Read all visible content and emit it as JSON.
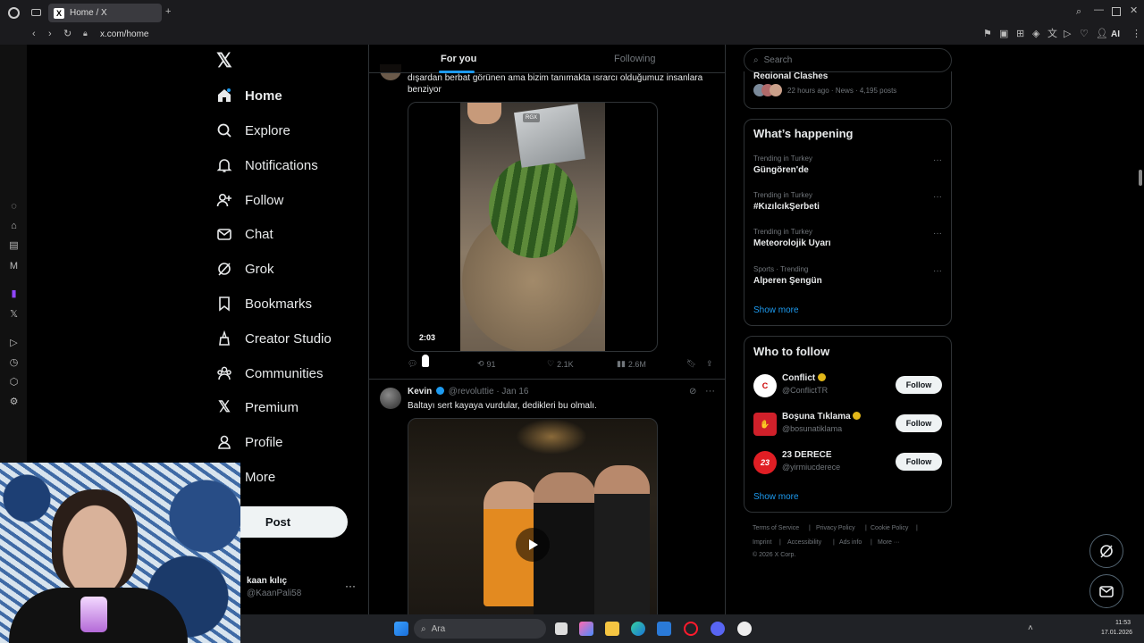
{
  "browser": {
    "tab_title": "Home / X",
    "url": "x.com/home",
    "ai_label": "AI"
  },
  "nav": {
    "items": [
      {
        "label": "Home",
        "icon": "home-icon"
      },
      {
        "label": "Explore",
        "icon": "search-icon"
      },
      {
        "label": "Notifications",
        "icon": "bell-icon"
      },
      {
        "label": "Follow",
        "icon": "person-add-icon"
      },
      {
        "label": "Chat",
        "icon": "mail-icon"
      },
      {
        "label": "Grok",
        "icon": "grok-icon"
      },
      {
        "label": "Bookmarks",
        "icon": "bookmark-icon"
      },
      {
        "label": "Creator Studio",
        "icon": "creator-icon"
      },
      {
        "label": "Communities",
        "icon": "communities-icon"
      },
      {
        "label": "Premium",
        "icon": "x-icon"
      },
      {
        "label": "Profile",
        "icon": "profile-icon"
      },
      {
        "label": "More",
        "icon": "more-icon"
      }
    ],
    "post_label": "Post",
    "account_name": "kaan kılıç",
    "account_handle": "@KaanPali58"
  },
  "feed": {
    "tabs": [
      "For you",
      "Following"
    ],
    "tweet1": {
      "text_line1": "dışardan berbat görünen ama bizim tanımakta ısrarcı olduğumuz insanlara",
      "text_line2": "benziyor",
      "video_duration": "2:03",
      "watermark": "RGX",
      "retweets": "91",
      "likes": "2.1K",
      "views": "2.6M"
    },
    "tweet2": {
      "author": "Kevin",
      "handle": "@revoluttie",
      "date": "· Jan 16",
      "text": "Baltayı sert kayaya vurdular, dedikleri bu olmalı."
    }
  },
  "right": {
    "search_placeholder": "Search",
    "top_card": {
      "title": "Regional Clashes",
      "meta": "22 hours ago · News · 4,195 posts"
    },
    "happening": {
      "title": "What’s happening",
      "trends": [
        {
          "meta": "Trending in Turkey",
          "name": "Güngören'de"
        },
        {
          "meta": "Trending in Turkey",
          "name": "#KızılcıkŞerbeti"
        },
        {
          "meta": "Trending in Turkey",
          "name": "Meteorolojik Uyarı"
        },
        {
          "meta": "Sports · Trending",
          "name": "Alperen Şengün"
        }
      ],
      "show_more": "Show more"
    },
    "who_to_follow": {
      "title": "Who to follow",
      "accounts": [
        {
          "name": "Conflict",
          "handle": "@ConflictTR",
          "avatar_text": "C",
          "avatar_color": "#ffffff"
        },
        {
          "name": "Boşuna Tıklama",
          "handle": "@bosunatiklama",
          "avatar_text": "✋",
          "avatar_color": "#d0202a"
        },
        {
          "name": "23 DERECE",
          "handle": "@yirmiucderece",
          "avatar_text": "23",
          "avatar_color": "#e01e24"
        }
      ],
      "follow_label": "Follow",
      "show_more": "Show more"
    },
    "footer": {
      "links": [
        "Terms of Service",
        "|",
        "Privacy Policy",
        "|",
        "Cookie Policy",
        "|",
        "Imprint",
        "|",
        "Accessibility",
        "|",
        "Ads info",
        "|",
        "More ···"
      ],
      "copyright": "© 2026 X Corp."
    }
  },
  "taskbar": {
    "search_placeholder": "Ara",
    "time": "11:53",
    "date": "17.01.2026"
  }
}
